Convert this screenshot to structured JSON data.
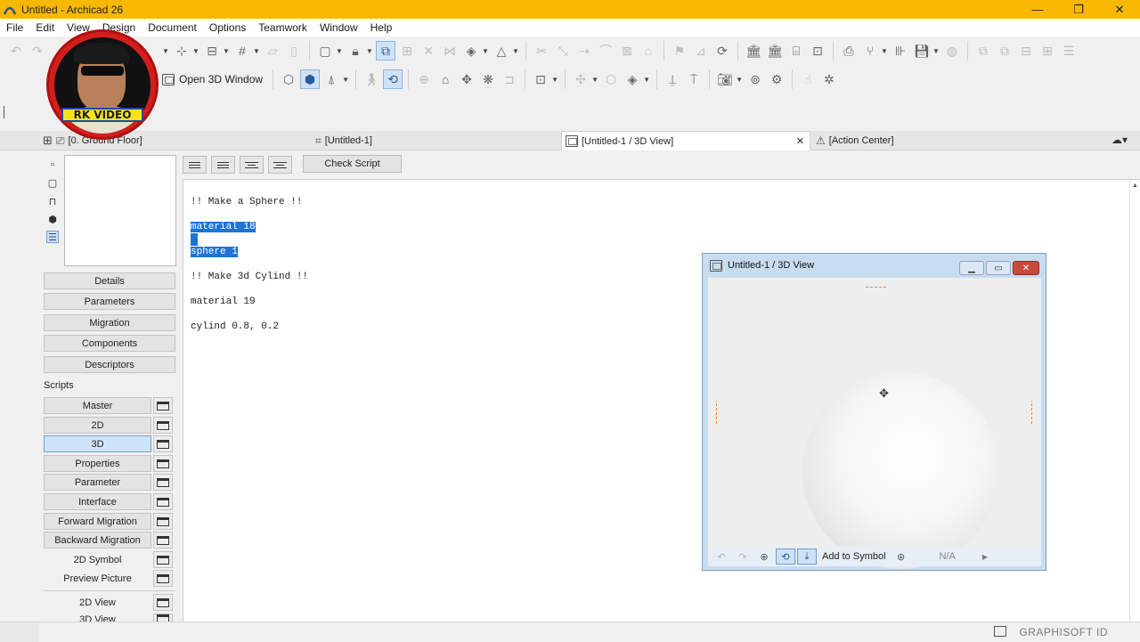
{
  "window": {
    "title": "Untitled - Archicad 26",
    "minimize": "—",
    "restore": "❐",
    "close": "✕"
  },
  "menu": [
    "File",
    "Edit",
    "View",
    "Design",
    "Document",
    "Options",
    "Teamwork",
    "Window",
    "Help"
  ],
  "toolbar2": {
    "open3d_label": "Open 3D Window"
  },
  "tabs": [
    {
      "label": "[0. Ground Floor]"
    },
    {
      "label": "[Untitled-1]"
    },
    {
      "label": "[Untitled-1 / 3D View]",
      "close": "✕"
    },
    {
      "label": "[Action Center]"
    }
  ],
  "left_panel": {
    "sections": [
      "Details",
      "Parameters",
      "Migration",
      "Components",
      "Descriptors"
    ],
    "scripts_label": "Scripts",
    "scripts": [
      {
        "label": "Master"
      },
      {
        "label": "2D"
      },
      {
        "label": "3D",
        "active": true
      },
      {
        "label": "Properties"
      },
      {
        "label": "Parameter"
      },
      {
        "label": "Interface"
      },
      {
        "label": "Forward Migration"
      },
      {
        "label": "Backward Migration"
      },
      {
        "label": "2D Symbol"
      },
      {
        "label": "Preview Picture"
      },
      {
        "label": "2D View"
      },
      {
        "label": "3D View"
      }
    ]
  },
  "editor": {
    "check_script": "Check Script",
    "lines": [
      "!! Make a Sphere !!",
      "material 18",
      "sphere 1",
      "!! Make 3d Cylind !!",
      "material 19",
      "cylind 0.8, 0.2"
    ],
    "selected_lines": [
      1,
      2
    ]
  },
  "view3d": {
    "title": "Untitled-1 / 3D View",
    "add_to_symbol": "Add to Symbol",
    "zoom": "N/A"
  },
  "status": {
    "brand": "GRAPHISOFT ID"
  },
  "logo": {
    "text": "RK VIDEO"
  },
  "colors": {
    "titlebar": "#f6b800",
    "selection": "#1e73d6",
    "logo_red": "#d41e1e",
    "logo_yellow": "#f5e41a"
  }
}
